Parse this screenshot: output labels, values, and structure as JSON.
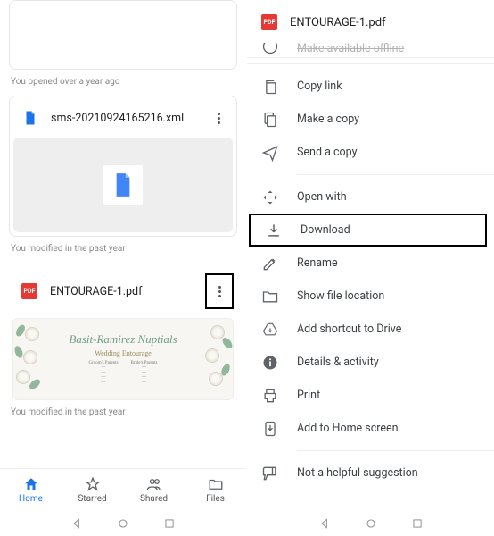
{
  "left": {
    "prev_meta": "You opened over a year ago",
    "file1": {
      "title": "sms-20210924165216.xml",
      "meta": "You modified in the past year"
    },
    "file2": {
      "title": "ENTOURAGE-1.pdf",
      "meta": "You modified in the past year",
      "thumb_heading": "Basit-Ramirez Nuptials",
      "thumb_sub": "Wedding Entourage",
      "thumb_left_head": "Groom's Parents",
      "thumb_right_head": "Bride's Parents"
    },
    "nav": {
      "home": "Home",
      "starred": "Starred",
      "shared": "Shared",
      "files": "Files"
    }
  },
  "right": {
    "file_title": "ENTOURAGE-1.pdf",
    "cutoff_label": "Make available offline",
    "items": {
      "copy_link": "Copy link",
      "make_copy": "Make a copy",
      "send_copy": "Send a copy",
      "open_with": "Open with",
      "download": "Download",
      "rename": "Rename",
      "show_location": "Show file location",
      "add_shortcut": "Add shortcut to Drive",
      "details": "Details & activity",
      "print": "Print",
      "add_home": "Add to Home screen",
      "not_helpful": "Not a helpful suggestion"
    }
  }
}
